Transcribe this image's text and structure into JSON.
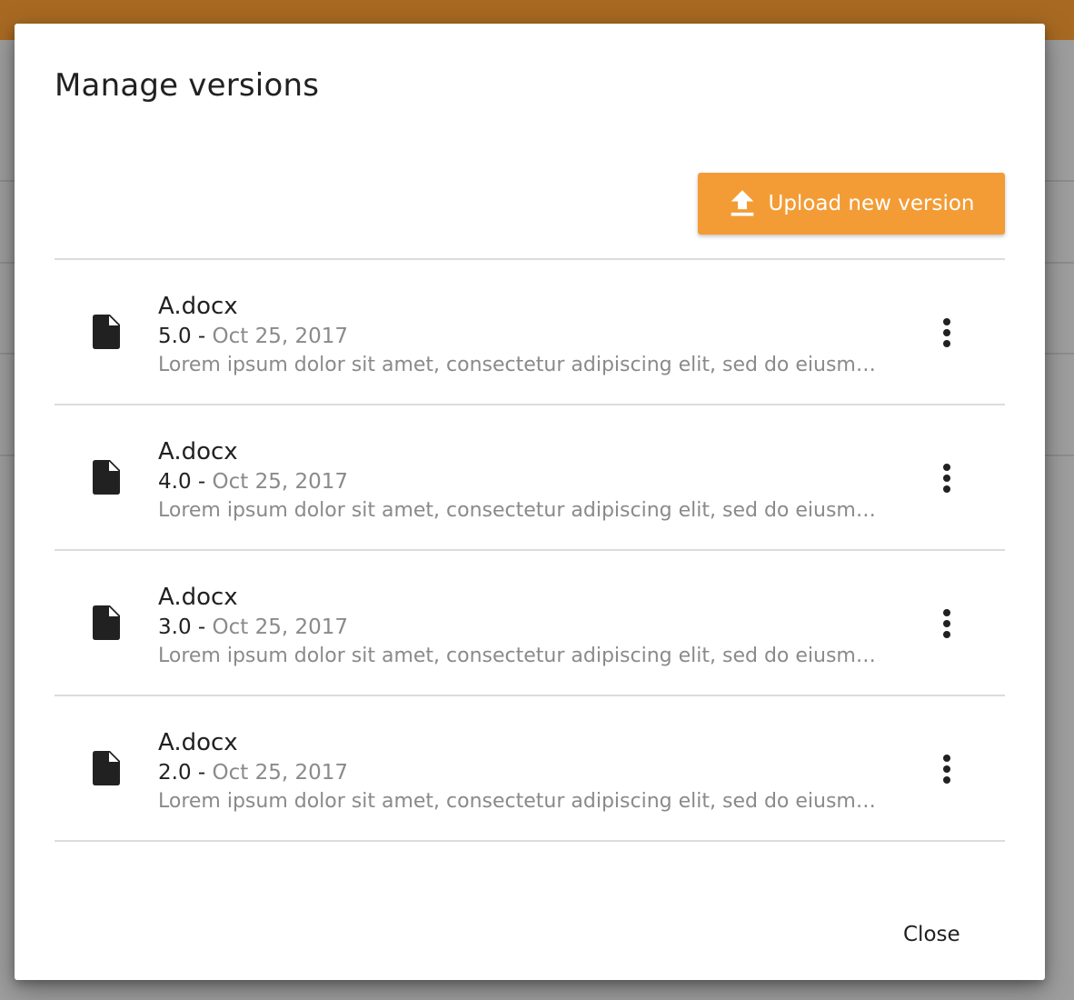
{
  "dialog": {
    "title": "Manage versions",
    "upload_label": "Upload new version",
    "close_label": "Close"
  },
  "versions": [
    {
      "file_name": "A.docx",
      "version": "5.0",
      "separator": " - ",
      "date": "Oct 25, 2017",
      "description": "Lorem ipsum dolor sit amet, consectetur adipiscing elit, sed do eiusmod tempor incididunt ut labore et dolore magna aliqua."
    },
    {
      "file_name": "A.docx",
      "version": "4.0",
      "separator": " - ",
      "date": "Oct 25, 2017",
      "description": "Lorem ipsum dolor sit amet, consectetur adipiscing elit, sed do eiusmod tempor incididunt ut labore et dolore magna aliqua."
    },
    {
      "file_name": "A.docx",
      "version": "3.0",
      "separator": " - ",
      "date": "Oct 25, 2017",
      "description": "Lorem ipsum dolor sit amet, consectetur adipiscing elit, sed do eiusmod tempor incididunt ut labore et dolore magna aliqua."
    },
    {
      "file_name": "A.docx",
      "version": "2.0",
      "separator": " - ",
      "date": "Oct 25, 2017",
      "description": "Lorem ipsum dolor sit amet, consectetur adipiscing elit, sed do eiusmod tempor incididunt ut labore et dolore magna aliqua."
    }
  ],
  "icons": {
    "upload": "upload-icon",
    "file": "file-icon",
    "more": "more-vertical-icon"
  },
  "colors": {
    "accent": "#f39c35",
    "app_bar": "#a86a22",
    "divider": "#dcdcdc",
    "secondary_text": "#8a8a8a",
    "primary_text": "#212121"
  }
}
